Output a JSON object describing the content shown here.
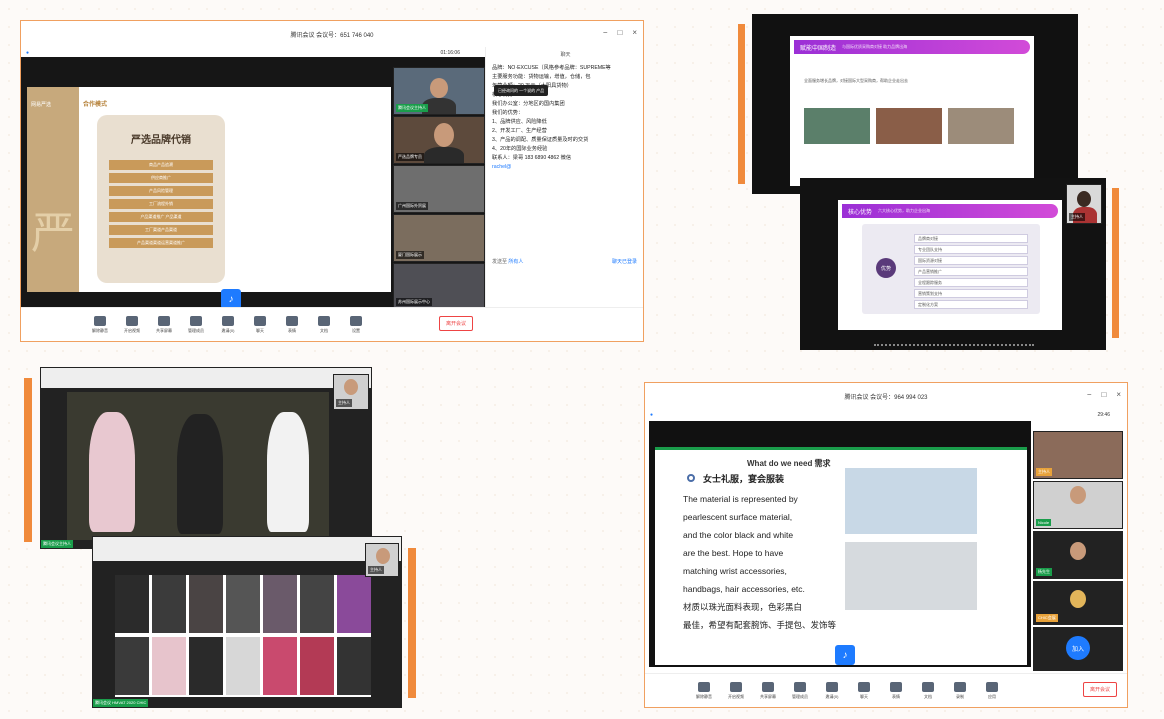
{
  "win1": {
    "title": "腾讯会议 会议号：651 746 040",
    "time": "01:16:06",
    "slide_heading": "合作模式",
    "brand_title": "严选品牌代销",
    "brand_items": [
      "商品产品追溯",
      "供应商推广",
      "产品风险管理",
      "工厂流程外销",
      "产品渠道推广 产品渠道",
      "工厂渠道产品渠道",
      "产品渠道渠道运营渠道推广"
    ],
    "logo_text": "网易严选",
    "chat_title": "聊天",
    "chat_lines": [
      "品牌：NO·EXCUSE（风格参考品牌：SUPREME等",
      "主要服务功能：货物运输，增值，仓储，包",
      "年营业额：20 万元（太阳具货物）",
      "核心优势",
      "我们办公室：分地区的国内集团",
      "我们的优势：",
      "1、品牌供应、风险降低",
      "2、开发工厂、生产经营",
      "3、产品的调配、质量保证质量及时的交货",
      "4、20年的国际业务经验",
      "联系人：梁哥 183 6890 4862 微信",
      "rachel@"
    ],
    "chat_popup": "已经询问的 一个说的 产品",
    "chat_recipient_label": "发送至",
    "chat_recipient": "所有人",
    "chat_status": "聊天已登录",
    "participants": [
      "腾讯会议主持人",
      "严选品牌专员",
      "广州国际外贸展",
      "厦门国际展示",
      "苏州国际展示中心"
    ],
    "toolbar": [
      "解除静音",
      "开启视频",
      "共享屏幕",
      "管理成员",
      "邀请(0)",
      "聊天",
      "表情",
      "文档",
      "设置"
    ],
    "leave": "离开会议"
  },
  "win2": {
    "slide1_header": "赋能中国制造",
    "slide1_sub": "与国际优质采购商对接  助力品牌出海",
    "slide1_text": "全面服务增长品牌，对接国际大型采购商，帮助企业走出去",
    "slide2_header": "核心优势",
    "slide2_sub": "六大核心优势，助力企业出海",
    "circle_label": "优势",
    "list_items": [
      "品牌商对接",
      "专业团队支持",
      "国际资源对接",
      "产品营销推广",
      "全程跟踪服务",
      "营销策划支持",
      "定制化方案"
    ],
    "speaker_tag": "主持人"
  },
  "win3": {
    "host_tag": "腾讯会议主持人",
    "speaker_tag": "主持人",
    "footer_text": "腾讯会议 HMVAT 2020 CHIC"
  },
  "win4": {
    "title": "腾讯会议 会议号：964 994 023",
    "time": "29:46",
    "slide_title": "What do we need  需求",
    "bullet": "女士礼服，宴会服装",
    "paragraph_lines": [
      "The material is represented by",
      "pearlescent surface material,",
      "and the color black and white",
      "are the best. Hope to have",
      "matching wrist accessories,",
      "handbags, hair accessories, etc.",
      "材质以珠光面料表现，色彩黑白",
      "最佳，希望有配套腕饰、手提包、发饰等"
    ],
    "participants": [
      "主持人",
      "Nicole",
      "杨先生",
      "CHIC会展"
    ],
    "host_tag": "腾讯会议主持人",
    "join_label": "加入",
    "toolbar": [
      "解除静音",
      "开启视频",
      "共享屏幕",
      "管理成员",
      "邀请(0)",
      "聊天",
      "表情",
      "文档",
      "录制",
      "应用"
    ],
    "leave": "离开会议"
  },
  "colors": {
    "accent": "#f08a3c",
    "tencent_blue": "#1e7bff",
    "brand_gold": "#c7a97c",
    "purple": "#9b2fd6",
    "host_green": "#1a9d4b"
  }
}
